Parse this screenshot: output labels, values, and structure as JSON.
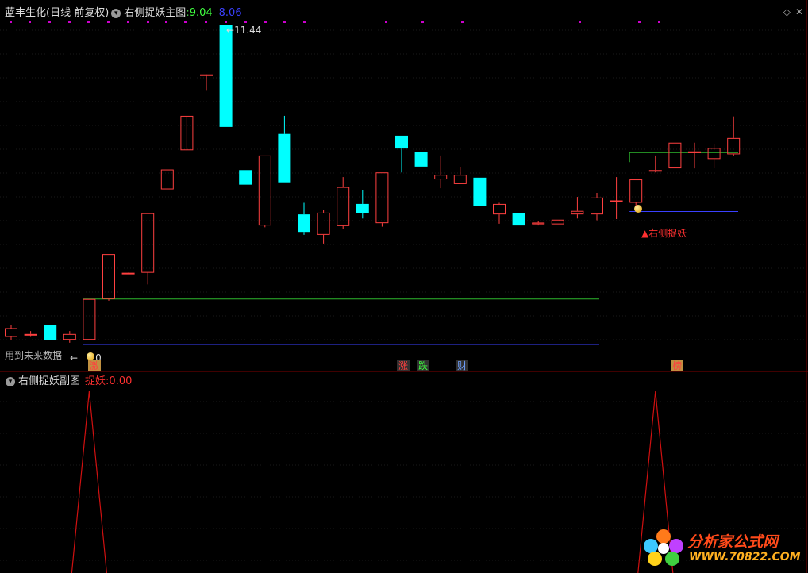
{
  "main_panel": {
    "stock_name": "蓝丰生化",
    "period_label": "(日线 前复权)",
    "indicator_name": "右侧捉妖主图",
    "value_green": "9.04",
    "value_blue": "8.06",
    "high_label": "11.44",
    "low_label": "0",
    "future_data_note": "用到未来数据",
    "signal_label": "▲右侧捉妖",
    "markers": [
      {
        "text": "激",
        "bg": "#c09040",
        "fg": "#ff4040"
      },
      {
        "text": "涨",
        "bg": "#303030",
        "fg": "#ff4040"
      },
      {
        "text": "跌",
        "bg": "#303030",
        "fg": "#40ff40"
      },
      {
        "text": "财",
        "bg": "#303030",
        "fg": "#6fa0ff"
      },
      {
        "text": "榜",
        "bg": "#c09040",
        "fg": "#ff4040"
      }
    ]
  },
  "sub_panel": {
    "indicator_name": "右侧捉妖副图",
    "series_label": "捉妖",
    "series_value": "0.00"
  },
  "watermark": {
    "title": "分析家公式网",
    "url": "WWW.70822.COM"
  },
  "icons": [
    "diamond-icon",
    "close-icon",
    "chevron-down-icon",
    "flower-logo-icon",
    "coin-icon"
  ],
  "colors": {
    "up": "#ff4040",
    "down": "#00ffff",
    "green_line": "#2db82d",
    "blue_line": "#3a40ff",
    "panel_divider": "#800000",
    "sub_signal": "#d01010",
    "purple_dots": "#cc00cc"
  },
  "chart_data": {
    "type": "candlestick",
    "y_high_marker": 11.44,
    "candles": [
      {
        "o": 6.1,
        "h": 6.3,
        "l": 6.05,
        "c": 6.25
      },
      {
        "o": 6.15,
        "h": 6.2,
        "l": 6.1,
        "c": 6.15
      },
      {
        "o": 6.3,
        "h": 6.3,
        "l": 6.05,
        "c": 6.05
      },
      {
        "o": 6.05,
        "h": 6.2,
        "l": 6.0,
        "c": 6.15
      },
      {
        "o": 6.05,
        "h": 6.75,
        "l": 6.05,
        "c": 6.75
      },
      {
        "o": 6.75,
        "h": 7.52,
        "l": 6.72,
        "c": 7.52
      },
      {
        "o": 7.2,
        "h": 7.2,
        "l": 7.2,
        "c": 7.2
      },
      {
        "o": 7.2,
        "h": 8.22,
        "l": 7.0,
        "c": 8.22
      },
      {
        "o": 8.63,
        "h": 8.97,
        "l": 8.63,
        "c": 8.97
      },
      {
        "o": 9.3,
        "h": 9.3,
        "l": 9.3,
        "c": 9.89
      },
      {
        "o": 10.58,
        "h": 10.58,
        "l": 10.32,
        "c": 10.6
      },
      {
        "o": 11.44,
        "h": 11.44,
        "l": 9.7,
        "c": 9.7
      },
      {
        "o": 8.96,
        "h": 8.96,
        "l": 8.71,
        "c": 8.71
      },
      {
        "o": 8.01,
        "h": 9.21,
        "l": 7.98,
        "c": 9.21
      },
      {
        "o": 9.58,
        "h": 9.89,
        "l": 8.75,
        "c": 8.75
      },
      {
        "o": 8.2,
        "h": 8.4,
        "l": 7.85,
        "c": 7.9
      },
      {
        "o": 7.85,
        "h": 8.28,
        "l": 7.7,
        "c": 8.23
      },
      {
        "o": 8.0,
        "h": 8.84,
        "l": 7.95,
        "c": 8.67
      },
      {
        "o": 8.38,
        "h": 8.61,
        "l": 8.13,
        "c": 8.22
      },
      {
        "o": 8.05,
        "h": 8.92,
        "l": 7.99,
        "c": 8.92
      },
      {
        "o": 9.55,
        "h": 9.55,
        "l": 8.92,
        "c": 9.33
      },
      {
        "o": 9.27,
        "h": 9.27,
        "l": 9.02,
        "c": 9.02
      },
      {
        "o": 8.8,
        "h": 9.21,
        "l": 8.65,
        "c": 8.88
      },
      {
        "o": 8.72,
        "h": 9.01,
        "l": 8.72,
        "c": 8.88
      },
      {
        "o": 8.83,
        "h": 8.83,
        "l": 8.35,
        "c": 8.35
      },
      {
        "o": 8.2,
        "h": 8.4,
        "l": 8.04,
        "c": 8.38
      },
      {
        "o": 8.22,
        "h": 8.22,
        "l": 8.01,
        "c": 8.01
      },
      {
        "o": 8.03,
        "h": 8.08,
        "l": 8.01,
        "c": 8.06
      },
      {
        "o": 8.03,
        "h": 8.11,
        "l": 8.03,
        "c": 8.11
      },
      {
        "o": 8.2,
        "h": 8.5,
        "l": 8.13,
        "c": 8.26
      },
      {
        "o": 8.2,
        "h": 8.57,
        "l": 8.1,
        "c": 8.49
      },
      {
        "o": 8.44,
        "h": 8.84,
        "l": 8.12,
        "c": 8.44
      },
      {
        "o": 8.4,
        "h": 8.8,
        "l": 8.33,
        "c": 8.8
      },
      {
        "o": 8.95,
        "h": 9.21,
        "l": 8.92,
        "c": 8.96
      },
      {
        "o": 8.99,
        "h": 9.43,
        "l": 8.99,
        "c": 9.43
      },
      {
        "o": 9.25,
        "h": 9.43,
        "l": 8.99,
        "c": 9.28
      },
      {
        "o": 9.15,
        "h": 9.41,
        "l": 8.99,
        "c": 9.34
      },
      {
        "o": 9.23,
        "h": 9.88,
        "l": 9.2,
        "c": 9.51
      }
    ],
    "green_level_1": 6.75,
    "blue_level_1": 5.97,
    "green_level_2": 9.26,
    "blue_level_2": 8.25,
    "sub_series": [
      0,
      0,
      0,
      0,
      1,
      0,
      0,
      0,
      0,
      0,
      0,
      0,
      0,
      0,
      0,
      0,
      0,
      0,
      0,
      0,
      0,
      0,
      0,
      0,
      0,
      0,
      0,
      0,
      0,
      0,
      0,
      0,
      0,
      1,
      0,
      0,
      0,
      0
    ]
  }
}
